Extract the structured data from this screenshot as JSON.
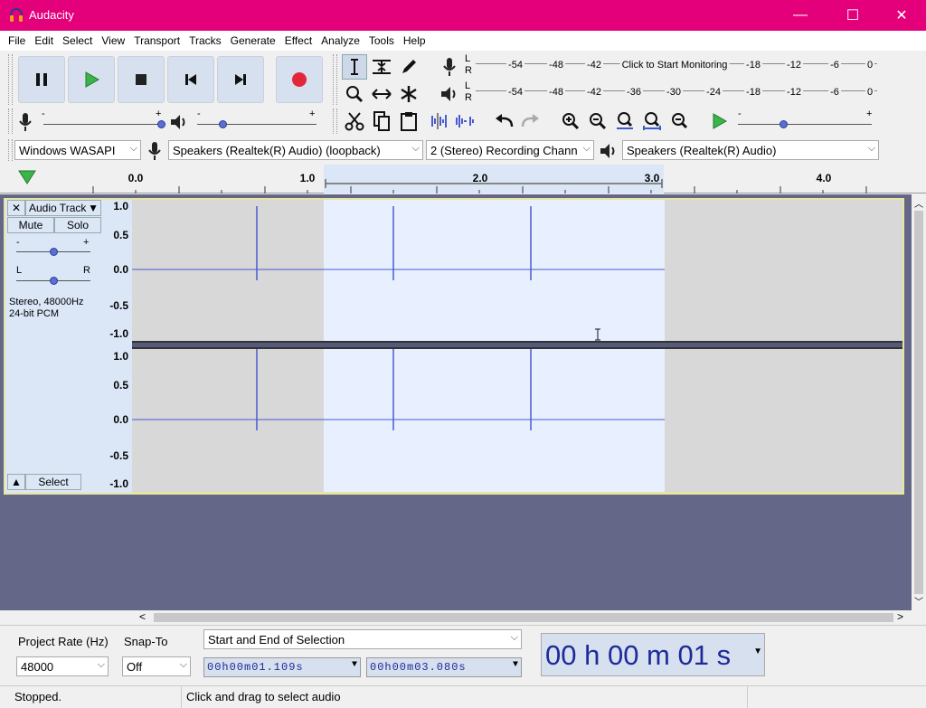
{
  "window": {
    "title": "Audacity",
    "minimize": "—",
    "maximize": "☐",
    "close": "✕",
    "accent": "#e3007a"
  },
  "menu": [
    "File",
    "Edit",
    "Select",
    "View",
    "Transport",
    "Tracks",
    "Generate",
    "Effect",
    "Analyze",
    "Tools",
    "Help"
  ],
  "meters": {
    "record": {
      "channels": [
        "L",
        "R"
      ],
      "labels": [
        "-54",
        "-48",
        "-42"
      ],
      "labels_right": [
        "-18",
        "-12",
        "-6",
        "0"
      ],
      "prompt": "Click to Start Monitoring"
    },
    "play": {
      "channels": [
        "L",
        "R"
      ],
      "labels": [
        "-54",
        "-48",
        "-42",
        "-36",
        "-30",
        "-24",
        "-18",
        "-12",
        "-6",
        "0"
      ]
    }
  },
  "mixer": {
    "minus": "-",
    "plus": "+"
  },
  "devices": {
    "host": "Windows WASAPI",
    "recording_device": "Speakers (Realtek(R) Audio) (loopback)",
    "channels": "2 (Stereo) Recording Chann",
    "playback_device": "Speakers (Realtek(R) Audio)"
  },
  "ruler": {
    "ticks": [
      "0.0",
      "1.0",
      "2.0",
      "3.0",
      "4.0"
    ]
  },
  "track": {
    "name": "Audio Track",
    "mute": "Mute",
    "solo": "Solo",
    "gain_minus": "-",
    "gain_plus": "+",
    "pan_left": "L",
    "pan_right": "R",
    "info_line1": "Stereo, 48000Hz",
    "info_line2": "24-bit PCM",
    "select": "Select",
    "scale": [
      "1.0",
      "0.5",
      "0.0",
      "-0.5",
      "-1.0"
    ]
  },
  "selection": {
    "project_rate_label": "Project Rate (Hz)",
    "project_rate": "48000",
    "snap_to_label": "Snap-To",
    "snap_to": "Off",
    "mode": "Start and End of Selection",
    "start": "00h00m01.109s",
    "end": "00h00m03.080s",
    "audio_position": "00 h 00 m 01 s"
  },
  "status": {
    "state": "Stopped.",
    "hint": "Click and drag to select audio"
  }
}
